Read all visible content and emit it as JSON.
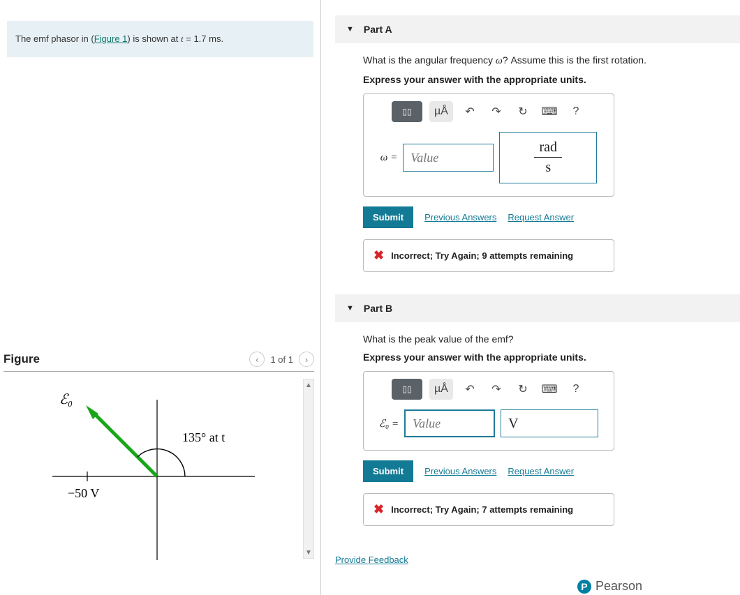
{
  "prompt": {
    "prefix": "The emf phasor in (",
    "figure_link": "Figure 1",
    "suffix1": ") is shown at ",
    "t_var": "t",
    "eq": " = 1.7 ms."
  },
  "figure": {
    "title": "Figure",
    "counter": "1 of 1",
    "labels": {
      "e0": "ℰ₀",
      "angle": "135° at  t",
      "xval": "−50 V"
    }
  },
  "partA": {
    "title": "Part A",
    "question_prefix": "What is the angular frequency ",
    "omega": "ω",
    "question_suffix": "? Assume this is the first rotation.",
    "instruction": "Express your answer with the appropriate units.",
    "var_label": "ω = ",
    "value_placeholder": "Value",
    "units_num": "rad",
    "units_den": "s",
    "submit": "Submit",
    "prev_answers": "Previous Answers",
    "request_answer": "Request Answer",
    "feedback": "Incorrect; Try Again; 9 attempts remaining"
  },
  "partB": {
    "title": "Part B",
    "question": "What is the peak value of the emf?",
    "instruction": "Express your answer with the appropriate units.",
    "var_label": "ℰ₀ = ",
    "value_placeholder": "Value",
    "units": "V",
    "submit": "Submit",
    "prev_answers": "Previous Answers",
    "request_answer": "Request Answer",
    "feedback": "Incorrect; Try Again; 7 attempts remaining"
  },
  "toolbar": {
    "t1": "▯▯",
    "t2": "µÅ",
    "undo": "↶",
    "redo": "↷",
    "reset": "↻",
    "keyboard": "⌨",
    "help": "?"
  },
  "links": {
    "provide_feedback": "Provide Feedback"
  },
  "brand": "Pearson"
}
